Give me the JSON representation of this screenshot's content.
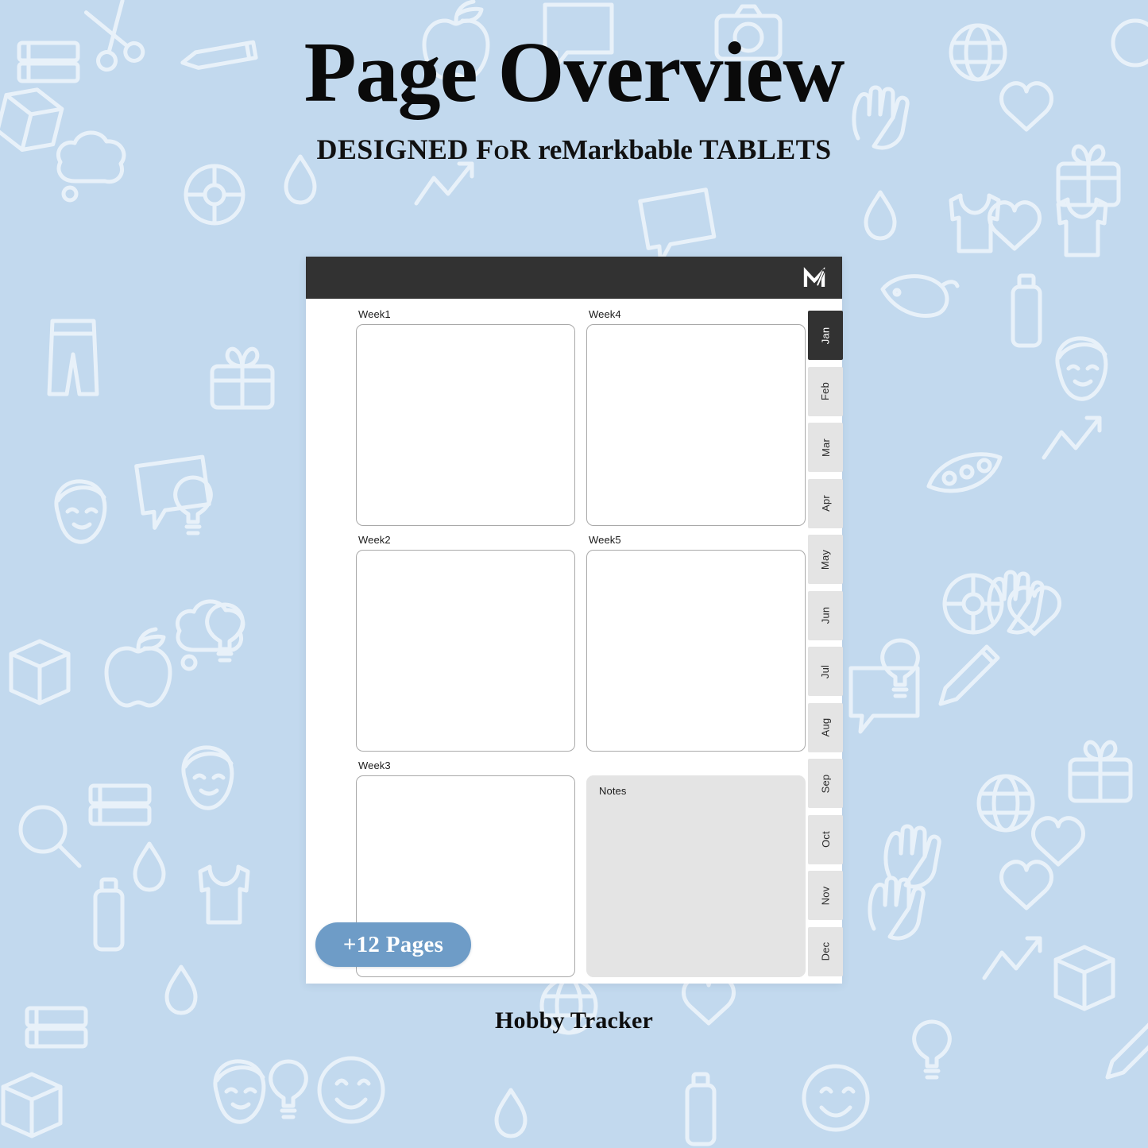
{
  "header": {
    "title": "Page Overview",
    "subtitle_prefix": "DESIGNED FoR ",
    "subtitle_brand": "reMarkbable",
    "subtitle_suffix": " TABLETS",
    "subtitle_full": "DESIGNED FoR reMarkbable TABLETS"
  },
  "background": {
    "color": "#c2d9ee",
    "icon_color": "#ffffff",
    "icon_names": [
      "scissors-icon",
      "glue-stick-icon",
      "apple-icon",
      "globe-icon",
      "heart-icon",
      "praying-hands-icon",
      "gift-icon",
      "tank-top-icon",
      "shrimp-icon",
      "lotion-tube-icon",
      "palette-icon",
      "magnifier-icon",
      "lightbulb-icon",
      "speech-bubble-icon",
      "face-icon",
      "smiley-icon",
      "jacket-icon",
      "pants-icon",
      "camera-icon",
      "thought-cloud-icon",
      "pencil-icon",
      "books-icon",
      "box-icon",
      "water-drop-icon",
      "pen-tablet-icon",
      "graph-icon",
      "peapod-icon"
    ]
  },
  "tablet": {
    "topbar": {
      "background": "#323232",
      "logo_name": "remarkable-m-logo"
    },
    "page_background": "#ffffff",
    "slots": [
      {
        "id": "week1",
        "label": "Week1",
        "type": "outline",
        "column": 1,
        "row": 1
      },
      {
        "id": "week4",
        "label": "Week4",
        "type": "outline",
        "column": 2,
        "row": 1
      },
      {
        "id": "week2",
        "label": "Week2",
        "type": "outline",
        "column": 1,
        "row": 2
      },
      {
        "id": "week5",
        "label": "Week5",
        "type": "outline",
        "column": 2,
        "row": 2
      },
      {
        "id": "week3",
        "label": "Week3",
        "type": "outline",
        "column": 1,
        "row": 3
      },
      {
        "id": "notes",
        "label": "Notes",
        "type": "filled",
        "column": 2,
        "row": 3,
        "fill": "#e4e4e4"
      }
    ],
    "month_tabs": {
      "active": "Jan",
      "active_background": "#323232",
      "inactive_background": "#e4e4e4",
      "items": [
        "Jan",
        "Feb",
        "Mar",
        "Apr",
        "May",
        "Jun",
        "Jul",
        "Aug",
        "Sep",
        "Oct",
        "Nov",
        "Dec"
      ]
    }
  },
  "badge": {
    "label": "+12 Pages",
    "color": "#6e9cc7"
  },
  "caption": {
    "text": "Hobby Tracker"
  }
}
